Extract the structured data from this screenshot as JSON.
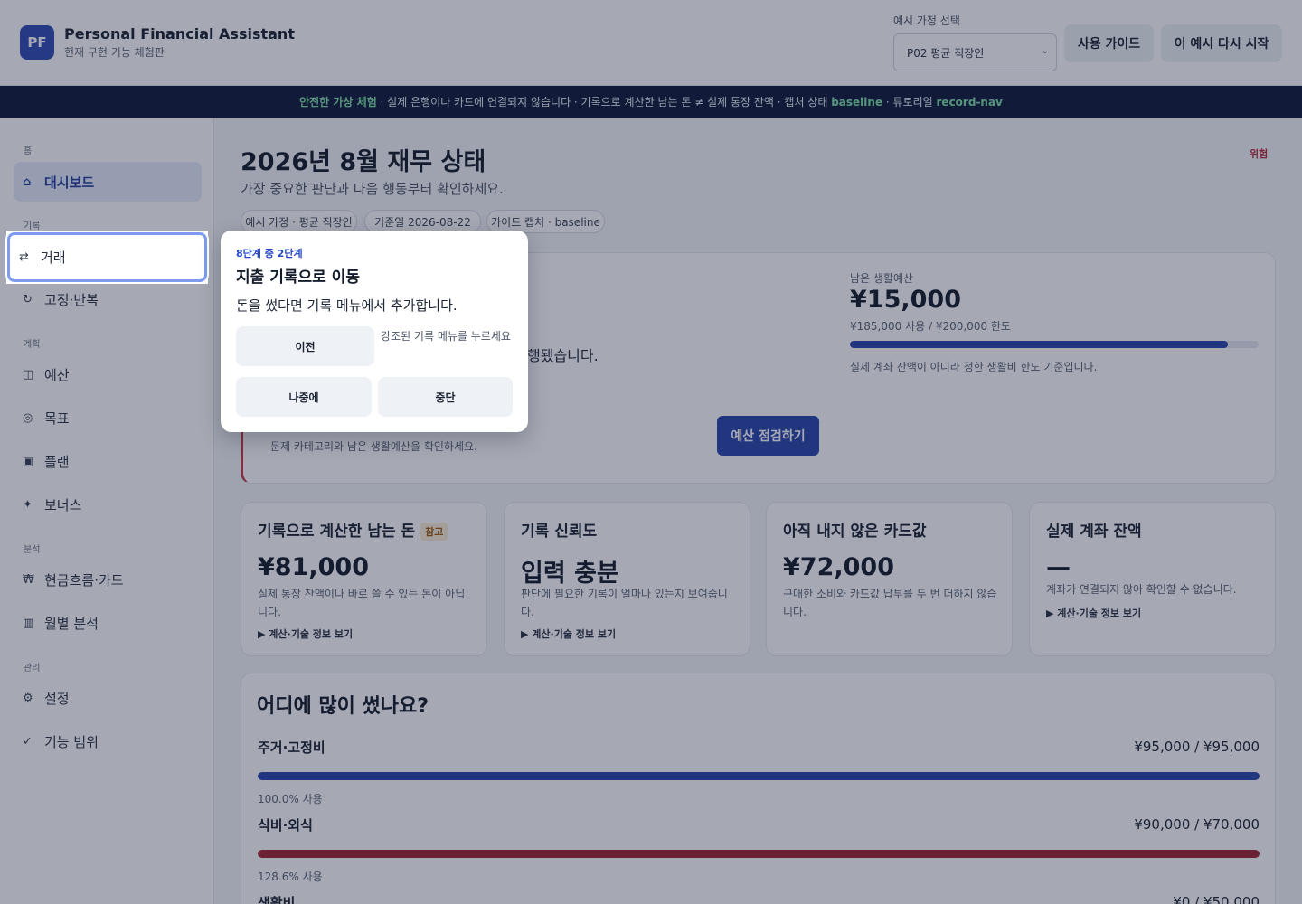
{
  "header": {
    "logo": "PF",
    "title": "Personal Financial Assistant",
    "subtitle": "현재 구현 기능 체험판",
    "household_label": "예시 가정 선택",
    "household_value": "P02 평균 직장인",
    "guide_button": "사용 가이드",
    "restart_button": "이 예시 다시 시작"
  },
  "banner": {
    "safe": "안전한 가상 체험",
    "text1": " · 실제 은행이나 카드에 연결되지 않습니다 · 기록으로 계산한 남는 돈 ≠ 실제 통장 잔액 · 캡처 상태 ",
    "capture": "baseline",
    "text2": " · 튜토리얼 ",
    "tutorial": "record-nav"
  },
  "sidebar": {
    "sections": [
      "홈",
      "기록",
      "계획",
      "분석",
      "관리"
    ],
    "items": [
      {
        "label": "대시보드",
        "icon": "⌂"
      },
      {
        "label": "거래",
        "icon": "⇄"
      },
      {
        "label": "고정·반복",
        "icon": "↻"
      },
      {
        "label": "예산",
        "icon": "◫"
      },
      {
        "label": "목표",
        "icon": "◎"
      },
      {
        "label": "플랜",
        "icon": "▣"
      },
      {
        "label": "보너스",
        "icon": "✦"
      },
      {
        "label": "현금흐름·카드",
        "icon": "₩"
      },
      {
        "label": "월별 분석",
        "icon": "▥"
      },
      {
        "label": "설정",
        "icon": "⚙"
      },
      {
        "label": "기능 범위",
        "icon": "✓"
      }
    ]
  },
  "main": {
    "title": "2026년 8월 재무 상태",
    "subtitle": "가장 중요한 판단과 다음 행동부터 확인하세요.",
    "risk": "위험",
    "chips": [
      "예시 가정 · 평균 직장인",
      "기준일 2026-08-22",
      "가이드 캡처 · baseline"
    ],
    "hero_text": "행됐습니다.",
    "hero_hint": "문제 카테고리와 남은 생활예산을 확인하세요.",
    "check_button": "예산 점검하기",
    "budget": {
      "label": "남은 생활예산",
      "value": "¥15,000",
      "detail": "¥185,000 사용 / ¥200,000 한도",
      "progress": 0.925,
      "note": "실제 계좌 잔액이 아니라 정한 생활비 한도 기준입니다."
    }
  },
  "cards": [
    {
      "title": "기록으로 계산한 남는 돈",
      "badge": "참고",
      "value": "¥81,000",
      "desc": "실제 통장 잔액이나 바로 쓸 수 있는 돈이 아닙니다.",
      "detail": "▶ 계산·기술 정보 보기"
    },
    {
      "title": "기록 신뢰도",
      "badge": "",
      "value": "입력 충분",
      "desc": "판단에 필요한 기록이 얼마나 있는지 보여줍니다.",
      "detail": "▶ 계산·기술 정보 보기"
    },
    {
      "title": "아직 내지 않은 카드값",
      "badge": "",
      "value": "¥72,000",
      "desc": "구매한 소비와 카드값 납부를 두 번 더하지 않습니다.",
      "detail": ""
    },
    {
      "title": "실제 계좌 잔액",
      "badge": "",
      "value": "—",
      "desc": "계좌가 연결되지 않아 확인할 수 없습니다.",
      "detail": "▶ 계산·기술 정보 보기"
    }
  ],
  "categories": {
    "title": "어디에 많이 썼나요?",
    "items": [
      {
        "name": "주거·고정비",
        "amount": "¥95,000 / ¥95,000",
        "ratio": 1.0,
        "pct": "100.0% 사용",
        "color": "#2b46ad"
      },
      {
        "name": "식비·외식",
        "amount": "¥90,000 / ¥70,000",
        "ratio": 1.0,
        "pct": "128.6% 사용",
        "color": "#9e2433"
      },
      {
        "name": "생활비",
        "amount": "¥0 / ¥50,000",
        "ratio": 0.0,
        "pct": "",
        "color": "#2b46ad"
      }
    ]
  },
  "tutorial": {
    "step": "8단계 중 2단계",
    "title": "지출 기록으로 이동",
    "body": "돈을 썼다면 기록 메뉴에서 추가합니다.",
    "prev": "이전",
    "hint": "강조된 기록 메뉴를 누르세요",
    "later": "나중에",
    "stop": "중단"
  }
}
